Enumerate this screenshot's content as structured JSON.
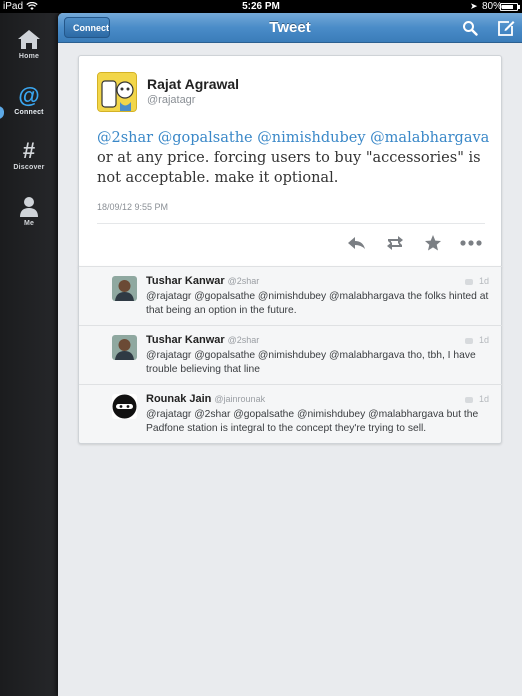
{
  "status_bar": {
    "device": "iPad",
    "time": "5:26 PM",
    "battery_pct": "80%",
    "battery_level": 0.8
  },
  "sidebar": {
    "items": [
      {
        "label": "Home",
        "icon": "home-icon",
        "active": false
      },
      {
        "label": "Connect",
        "icon": "at-icon",
        "active": true
      },
      {
        "label": "Discover",
        "icon": "hash-icon",
        "active": false
      },
      {
        "label": "Me",
        "icon": "person-icon",
        "active": false
      }
    ]
  },
  "navbar": {
    "back_label": "Connect",
    "title": "Tweet"
  },
  "tweet": {
    "author_name": "Rajat Agrawal",
    "author_handle": "@rajatagr",
    "mentions": [
      "@2shar",
      "@gopalsathe",
      "@nimishdubey",
      "@malabhargava"
    ],
    "text_rest": "or at any price. forcing users to buy \"accessories\" is not acceptable. make it optional.",
    "timestamp": "18/09/12 9:55 PM"
  },
  "replies": [
    {
      "name": "Tushar Kanwar",
      "handle": "@2shar",
      "text": "@rajatagr @gopalsathe @nimishdubey @malabhargava the folks hinted at that being an option in the future.",
      "time": "1d"
    },
    {
      "name": "Tushar Kanwar",
      "handle": "@2shar",
      "text": "@rajatagr @gopalsathe @nimishdubey @malabhargava tho, tbh, I have trouble believing that line",
      "time": "1d"
    },
    {
      "name": "Rounak Jain",
      "handle": "@jainrounak",
      "text": "@rajatagr @2shar @gopalsathe @nimishdubey @malabhargava but the Padfone station is integral to the concept they're trying to sell.",
      "time": "1d"
    }
  ],
  "colors": {
    "accent": "#3a88c8",
    "navbar": "#4a8cc8",
    "sidebar_active": "#3aa6f0"
  }
}
